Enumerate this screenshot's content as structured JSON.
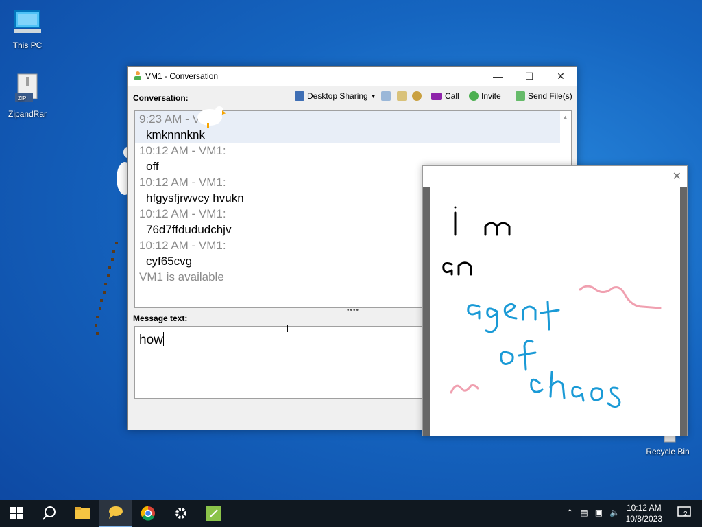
{
  "desktop": {
    "icons": [
      {
        "label": "This PC"
      },
      {
        "label": "ZipandRar"
      },
      {
        "label": "Recycle Bin"
      }
    ]
  },
  "window": {
    "title": "VM1 - Conversation",
    "conversation_label": "Conversation:",
    "toolbar": {
      "desktop_sharing": "Desktop Sharing",
      "call": "Call",
      "invite": "Invite",
      "send_files": "Send File(s)"
    },
    "messages": [
      {
        "time": "9:23 AM - VM1:",
        "text": "kmknnnknk"
      },
      {
        "time": "10:12 AM - VM1:",
        "text": "off"
      },
      {
        "time": "10:12 AM - VM1:",
        "text": "hfgysfjrwvcy hvukn"
      },
      {
        "time": "10:12 AM - VM1:",
        "text": "76d7ffdududchjv"
      },
      {
        "time": "10:12 AM - VM1:",
        "text": "cyf65cvg"
      }
    ],
    "status": "VM1 is available",
    "message_label": "Message text:",
    "message_value": "how"
  },
  "drawing": {
    "lines": [
      "i m",
      "an",
      "agent",
      "of",
      "chaos"
    ],
    "colors": {
      "black": "#000000",
      "blue": "#1a9ad6",
      "pink": "#f0a0b0"
    }
  },
  "taskbar": {
    "time": "10:12 AM",
    "date": "10/8/2023",
    "notifications": "2"
  }
}
